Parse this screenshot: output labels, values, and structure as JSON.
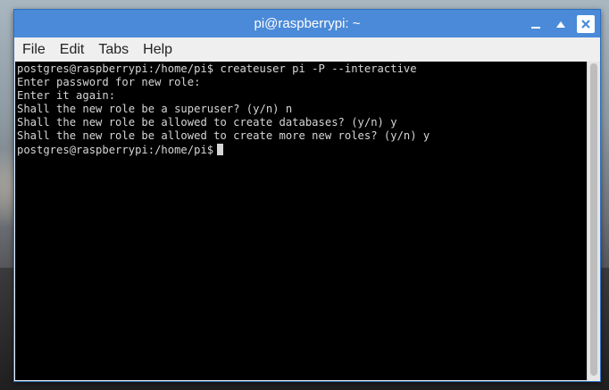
{
  "window": {
    "title": "pi@raspberrypi: ~",
    "menu": [
      "File",
      "Edit",
      "Tabs",
      "Help"
    ]
  },
  "terminal": {
    "lines": [
      "postgres@raspberrypi:/home/pi$ createuser pi -P --interactive",
      "Enter password for new role:",
      "Enter it again:",
      "Shall the new role be a superuser? (y/n) n",
      "Shall the new role be allowed to create databases? (y/n) y",
      "Shall the new role be allowed to create more new roles? (y/n) y",
      "postgres@raspberrypi:/home/pi$"
    ]
  },
  "icons": {
    "minimize": "minimize-icon",
    "maximize": "maximize-icon",
    "close": "close-icon"
  },
  "colors": {
    "titlebar": "#4b8ad8",
    "terminal_bg": "#000000",
    "terminal_fg": "#d6d6d6"
  }
}
